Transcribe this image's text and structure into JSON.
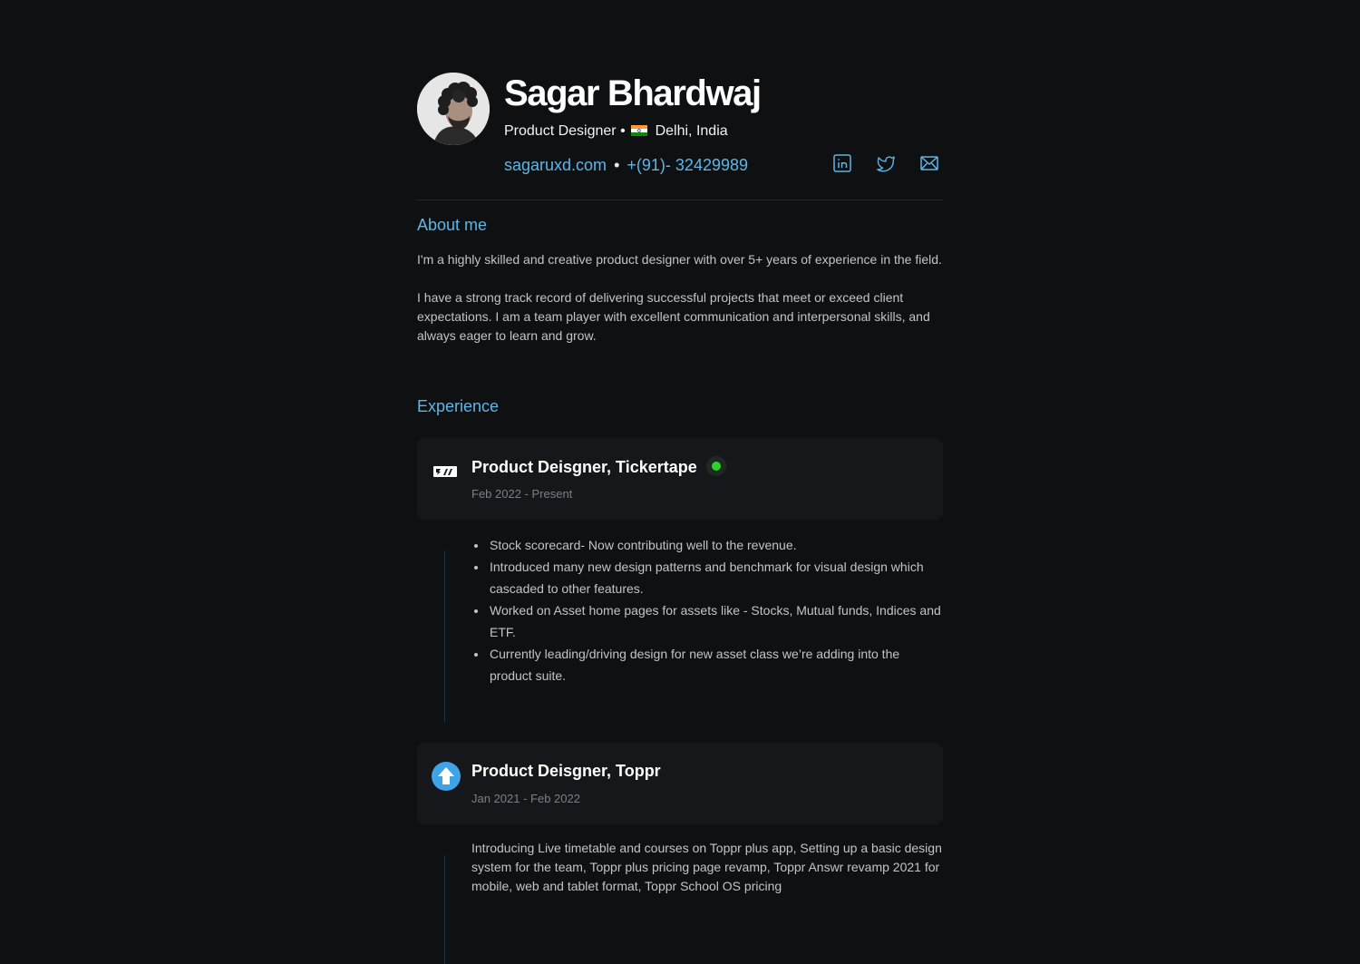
{
  "profile": {
    "name": "Sagar Bhardwaj",
    "role": "Product Designer",
    "location": "Delhi, India",
    "location_flag_icon": "india-flag-icon",
    "website": "sagaruxd.com",
    "phone": "+(91)- 32429989",
    "separator": "•",
    "socials": [
      "linkedin-icon",
      "twitter-icon",
      "mail-icon"
    ]
  },
  "about": {
    "title": "About me",
    "paragraphs": [
      "I'm a highly skilled and creative product designer with over 5+ years of experience in the field.",
      "I have a strong track record of delivering successful projects that meet or exceed client expectations. I am a team player with excellent communication and interpersonal skills, and always eager to learn and grow."
    ]
  },
  "experience": {
    "title": "Experience",
    "jobs": [
      {
        "title": "Product Deisgner, Tickertape",
        "dates": "Feb 2022 - Present",
        "active": true,
        "logo_icon": "tickertape-logo-icon",
        "bullets": [
          "Stock scorecard- Now contributing well to the revenue.",
          "Introduced many new design patterns and benchmark for visual design which cascaded to other features.",
          "Worked on Asset home pages for assets like - Stocks, Mutual funds, Indices and ETF.",
          "Currently leading/driving design for new asset class we’re adding into the product suite."
        ]
      },
      {
        "title": "Product Deisgner, Toppr",
        "dates": "Jan 2021 - Feb 2022",
        "active": false,
        "logo_icon": "toppr-logo-icon",
        "description": "Introducing Live timetable and courses on Toppr plus app, Setting up a basic design system for the team, Toppr plus pricing page revamp, Toppr Answr revamp 2021 for mobile, web and tablet format, Toppr School OS pricing"
      }
    ]
  },
  "colors": {
    "background": "#0f1012",
    "accent": "#5eb6e6",
    "card": "#15171a",
    "active_status": "#2bd42b"
  }
}
